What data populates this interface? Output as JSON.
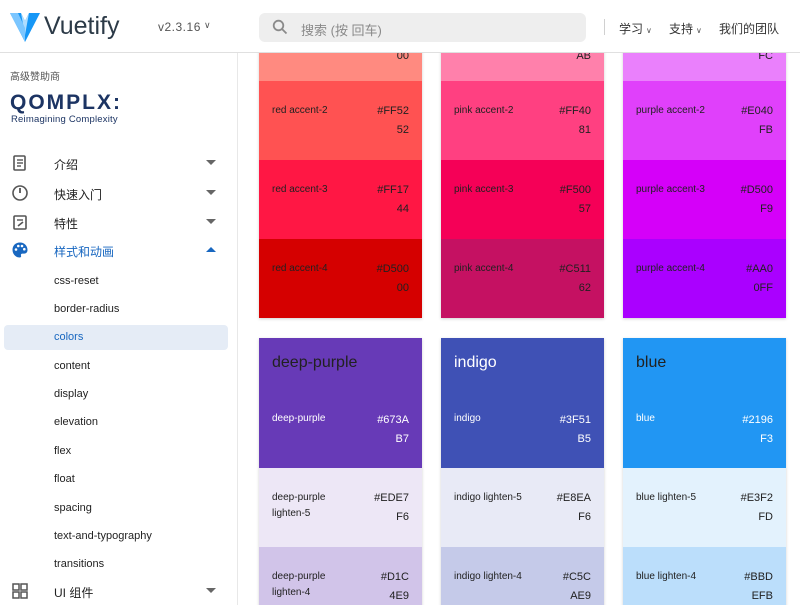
{
  "header": {
    "brand": "Vuetify",
    "version": "v2.3.16",
    "search_placeholder": "搜索 (按 回车)",
    "nav": [
      {
        "label": "学习",
        "has_menu": true
      },
      {
        "label": "支持",
        "has_menu": true
      },
      {
        "label": "我们的团队",
        "has_menu": false
      }
    ]
  },
  "sidebar": {
    "sponsor_label": "高级赞助商",
    "sponsor_name": "QOMPLX:",
    "sponsor_tagline": "Reimagining Complexity",
    "groups": [
      {
        "label": "介绍",
        "icon": "book-icon",
        "open": false
      },
      {
        "label": "快速入门",
        "icon": "speedometer-icon",
        "open": false
      },
      {
        "label": "特性",
        "icon": "clipboard-edit-icon",
        "open": false
      },
      {
        "label": "样式和动画",
        "icon": "palette-icon",
        "open": true
      }
    ],
    "sub_items": [
      "css-reset",
      "border-radius",
      "colors",
      "content",
      "display",
      "elevation",
      "flex",
      "float",
      "spacing",
      "text-and-typography",
      "transitions"
    ],
    "active_sub_item": "colors",
    "last_group": {
      "label": "UI 组件",
      "icon": "view-dashboard-icon"
    }
  },
  "colors": {
    "top_row": [
      {
        "name": "red",
        "partial_hex": "00",
        "partial_color": "#ff8a80",
        "swatches": [
          {
            "name": "red accent-2",
            "hex1": "#FF52",
            "hex2": "52",
            "bg": "#ff5252",
            "fg": "#212121"
          },
          {
            "name": "red accent-3",
            "hex1": "#FF17",
            "hex2": "44",
            "bg": "#ff1744",
            "fg": "#212121"
          },
          {
            "name": "red accent-4",
            "hex1": "#D500",
            "hex2": "00",
            "bg": "#d50000",
            "fg": "#212121"
          }
        ]
      },
      {
        "name": "pink",
        "partial_hex": "AB",
        "partial_color": "#ff80ab",
        "swatches": [
          {
            "name": "pink accent-2",
            "hex1": "#FF40",
            "hex2": "81",
            "bg": "#ff4081",
            "fg": "#212121"
          },
          {
            "name": "pink accent-3",
            "hex1": "#F500",
            "hex2": "57",
            "bg": "#f50057",
            "fg": "#212121"
          },
          {
            "name": "pink accent-4",
            "hex1": "#C511",
            "hex2": "62",
            "bg": "#c51162",
            "fg": "#212121"
          }
        ]
      },
      {
        "name": "purple",
        "partial_hex": "FC",
        "partial_color": "#ea80fc",
        "swatches": [
          {
            "name": "purple accent-2",
            "hex1": "#E040",
            "hex2": "FB",
            "bg": "#e040fb",
            "fg": "#212121"
          },
          {
            "name": "purple accent-3",
            "hex1": "#D500",
            "hex2": "F9",
            "bg": "#d500f9",
            "fg": "#212121"
          },
          {
            "name": "purple accent-4",
            "hex1": "#AA0",
            "hex2": "0FF",
            "bg": "#aa00ff",
            "fg": "#212121"
          }
        ]
      }
    ],
    "bottom_row": [
      {
        "title": "deep-purple",
        "head_bg": "#673ab7",
        "head_fg": "#212121",
        "swatches": [
          {
            "name": "deep-purple",
            "hex1": "#673A",
            "hex2": "B7",
            "bg": "#673ab7",
            "fg": "#ffffff"
          },
          {
            "name": "deep-purple lighten-5",
            "hex1": "#EDE7",
            "hex2": "F6",
            "bg": "#ede7f6",
            "fg": "#212121"
          },
          {
            "name": "deep-purple lighten-4",
            "hex1": "#D1C",
            "hex2": "4E9",
            "bg": "#d1c4e9",
            "fg": "#212121"
          }
        ]
      },
      {
        "title": "indigo",
        "head_bg": "#3f51b5",
        "head_fg": "#ffffff",
        "swatches": [
          {
            "name": "indigo",
            "hex1": "#3F51",
            "hex2": "B5",
            "bg": "#3f51b5",
            "fg": "#ffffff"
          },
          {
            "name": "indigo lighten-5",
            "hex1": "#E8EA",
            "hex2": "F6",
            "bg": "#e8eaf6",
            "fg": "#212121"
          },
          {
            "name": "indigo lighten-4",
            "hex1": "#C5C",
            "hex2": "AE9",
            "bg": "#c5cae9",
            "fg": "#212121"
          }
        ]
      },
      {
        "title": "blue",
        "head_bg": "#2196f3",
        "head_fg": "#212121",
        "swatches": [
          {
            "name": "blue",
            "hex1": "#2196",
            "hex2": "F3",
            "bg": "#2196f3",
            "fg": "#ffffff"
          },
          {
            "name": "blue lighten-5",
            "hex1": "#E3F2",
            "hex2": "FD",
            "bg": "#e3f2fd",
            "fg": "#212121"
          },
          {
            "name": "blue lighten-4",
            "hex1": "#BBD",
            "hex2": "EFB",
            "bg": "#bbdefb",
            "fg": "#212121"
          }
        ]
      }
    ]
  }
}
